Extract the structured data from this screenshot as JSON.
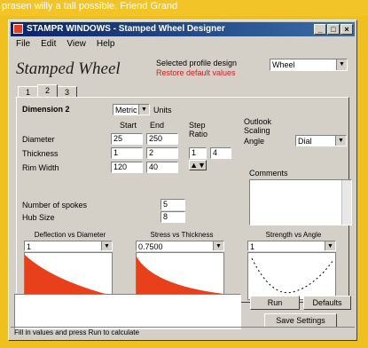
{
  "page_top_text": "prasen willy a tall possible. Friend Grand",
  "window": {
    "title": "STAMPR WINDOWS - Stamped Wheel Designer",
    "title_buttons": [
      "_",
      "□",
      "×"
    ]
  },
  "menu": [
    "File",
    "Edit",
    "View",
    "Help"
  ],
  "header": {
    "big_title": "Stamped Wheel",
    "path_label": "Selected profile design",
    "path_sub": "Restore default values",
    "profile_combo": "Wheel"
  },
  "tabs": [
    "1",
    "2",
    "3"
  ],
  "form": {
    "dimension_label": "Dimension 2",
    "mode_combo": "Metric",
    "mode_suffix": "Units",
    "col_from": "Start",
    "col_to": "End",
    "col_step": "Step",
    "col_step2": "Ratio",
    "rows": [
      {
        "label": "Diameter",
        "from": "25",
        "to": "250"
      },
      {
        "label": "Thickness",
        "from": "1",
        "to": "2"
      },
      {
        "label": "Rim Width",
        "from": "120",
        "to": "40"
      }
    ],
    "steps": [
      "1",
      "4"
    ],
    "outlook_label": "Outlook",
    "outlook_sub": "Scaling",
    "outlook_sub2": "Angle",
    "outlook_combo": "Dial",
    "comments_label": "Comments",
    "spokes_label": "Number of spokes",
    "spokes_value": "5",
    "hub_label": "Hub Size",
    "hub_value": "8"
  },
  "charts": [
    {
      "title": "Deflection vs Diameter",
      "combo": "1",
      "fill": "#e8401a"
    },
    {
      "title": "Stress vs Thickness",
      "combo": "0.7500",
      "fill": "#e8401a"
    },
    {
      "title": "Strength vs Angle",
      "combo": "1",
      "fill": "#ffffff"
    }
  ],
  "buttons": {
    "run": "Run",
    "defaults": "Defaults",
    "save": "Save Settings"
  },
  "status": "Fill in values and press Run to calculate"
}
